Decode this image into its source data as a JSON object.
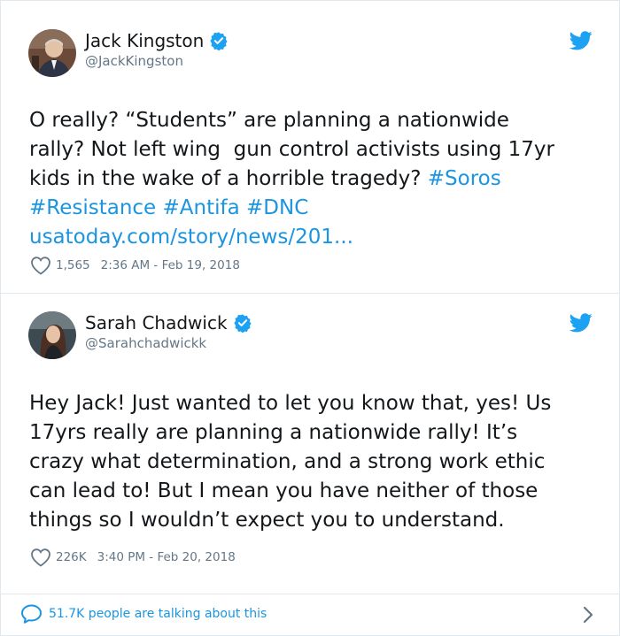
{
  "tweets": [
    {
      "name": "Jack Kingston",
      "handle": "@JackKingston",
      "text_lines": [
        "O really? “Students” are planning a nationwide",
        "rally? Not left wing  gun control activists using 17yr",
        "kids in the wake of a horrible tragedy? "
      ],
      "tags": [
        "#Soros",
        "#Resistance",
        "#Antifa",
        "#DNC"
      ],
      "link": "usatoday.com/story/news/201...",
      "likes": "1,565",
      "timestamp": "2:36 AM - Feb 19, 2018"
    },
    {
      "name": "Sarah Chadwick",
      "handle": "@Sarahchadwickk",
      "text": "Hey Jack! Just wanted to let you know that, yes! Us\n17yrs really are planning a nationwide rally! It’s\ncrazy what determination, and a strong work ethic\ncan lead to! But I mean you have neither of those\nthings so I wouldn’t expect you to understand.",
      "likes": "226K",
      "timestamp": "3:40 PM - Feb 20, 2018"
    }
  ],
  "footer": {
    "talking": "51.7K people are talking about this"
  },
  "colors": {
    "link": "#1b95e0",
    "secondary": "#657786",
    "border": "#e1e8ed"
  },
  "icons": [
    "verified-badge-icon",
    "twitter-bird-icon",
    "heart-icon",
    "speech-bubble-icon",
    "chevron-right-icon"
  ]
}
